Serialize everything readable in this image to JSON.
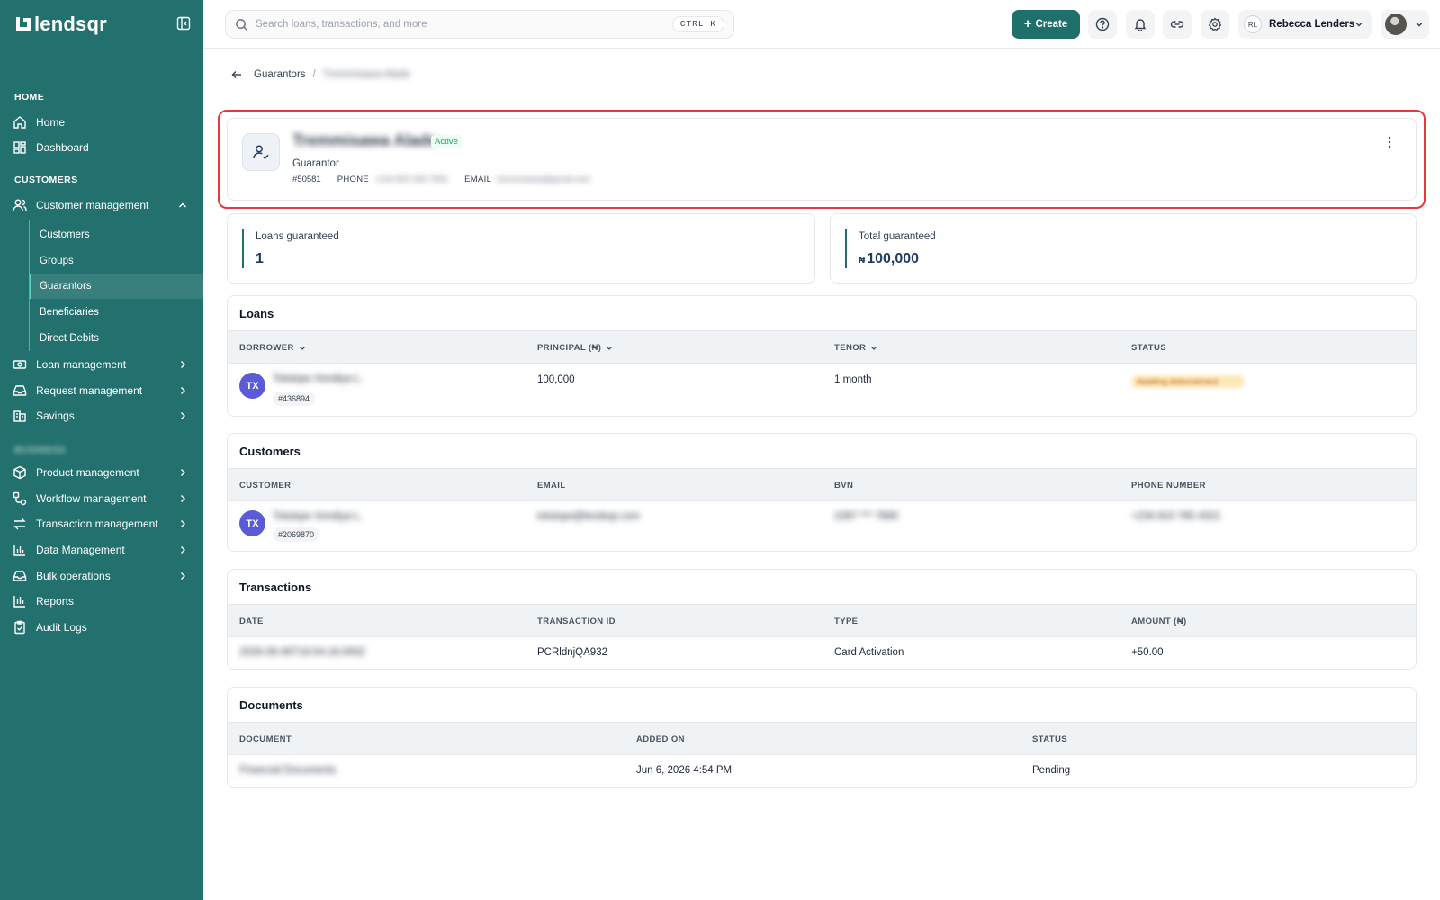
{
  "brand": {
    "name": "lendsqr"
  },
  "search": {
    "placeholder": "Search loans, transactions, and more",
    "shortcut": "CTRL K"
  },
  "topbar": {
    "create_label": "Create",
    "user_initials": "RL",
    "user_name": "Rebecca Lenders"
  },
  "sidebar": {
    "home_section": "HOME",
    "home": "Home",
    "dashboard": "Dashboard",
    "customers_section": "CUSTOMERS",
    "customer_management": "Customer management",
    "sub_items": [
      "Customers",
      "Groups",
      "Guarantors",
      "Beneficiaries",
      "Direct Debits"
    ],
    "loan_management": "Loan management",
    "request_management": "Request management",
    "savings": "Savings",
    "hidden_section": "BUSINESS",
    "product_management": "Product management",
    "workflow_management": "Workflow management",
    "transaction_management": "Transaction management",
    "data_management": "Data Management",
    "bulk_operations": "Bulk operations",
    "reports": "Reports",
    "audit_logs": "Audit Logs"
  },
  "breadcrumb": {
    "parent": "Guarantors",
    "current": "Tremmisawa Alade"
  },
  "profile": {
    "name": "Tremmisawa Alade",
    "status": "Active",
    "role": "Guarantor",
    "id": "#50581",
    "phone_label": "PHONE",
    "phone": "+234 803 456 7891",
    "email_label": "EMAIL",
    "email": "tremmisawa@gmail.com"
  },
  "stats": {
    "loans_guaranteed_label": "Loans guaranteed",
    "loans_guaranteed_value": "1",
    "total_guaranteed_label": "Total guaranteed",
    "total_guaranteed_currency": "₦",
    "total_guaranteed_value": "100,000"
  },
  "loans": {
    "title": "Loans",
    "headers": [
      "BORROWER",
      "PRINCIPAL (₦)",
      "TENOR",
      "STATUS"
    ],
    "rows": [
      {
        "initials": "TX",
        "name": "Tolulope Xendiya L.",
        "id": "#436894",
        "principal": "100,000",
        "tenor": "1 month",
        "status": "Awaiting disbursement"
      }
    ]
  },
  "customers": {
    "title": "Customers",
    "headers": [
      "CUSTOMER",
      "EMAIL",
      "BVN",
      "PHONE NUMBER"
    ],
    "rows": [
      {
        "initials": "TX",
        "name": "Tolulope Xendiya L.",
        "id": "#2069870",
        "email": "tolulope@lendsqr.com",
        "bvn": "2287 *** 7890",
        "phone": "+234 810 765 4321"
      }
    ]
  },
  "transactions": {
    "title": "Transactions",
    "headers": [
      "DATE",
      "TRANSACTION ID",
      "TYPE",
      "AMOUNT (₦)"
    ],
    "rows": [
      {
        "date": "2026-06-06T16:54:18.000Z",
        "id": "PCRldnjQA932",
        "type": "Card Activation",
        "amount": "+50.00"
      }
    ]
  },
  "documents": {
    "title": "Documents",
    "headers": [
      "DOCUMENT",
      "ADDED ON",
      "STATUS"
    ],
    "rows": [
      {
        "document": "Financial Documents",
        "added_on": "Jun 6, 2026 4:54 PM",
        "status": "Pending"
      }
    ]
  },
  "colors": {
    "sidebar": "#23716f",
    "primary": "#1f6f6b",
    "highlight": "#e5383b",
    "avatar": "#5b5bd6",
    "active": "#22a06b"
  }
}
